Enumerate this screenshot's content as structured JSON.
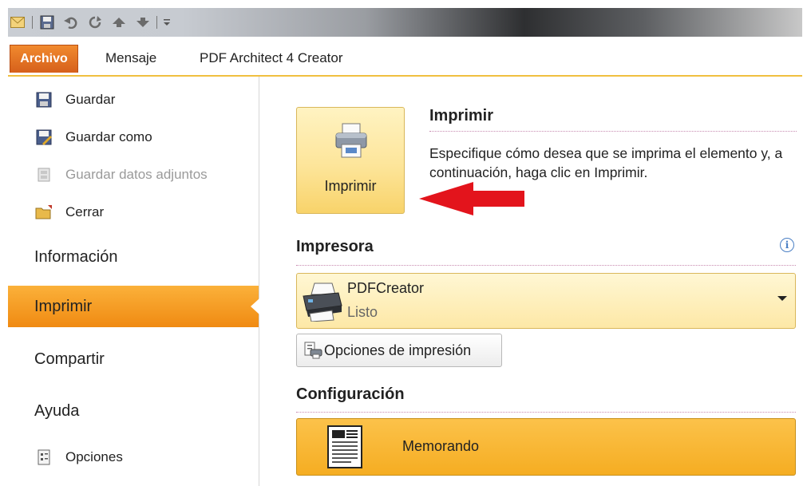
{
  "quick_access": {
    "icons": [
      "mail-icon",
      "save-icon",
      "undo-icon",
      "redo-icon",
      "up-arrow-icon",
      "down-arrow-icon",
      "customize-icon"
    ]
  },
  "tabs": [
    {
      "label": "Archivo",
      "active": true
    },
    {
      "label": "Mensaje"
    },
    {
      "label": "PDF Architect 4 Creator"
    }
  ],
  "left_nav": {
    "commands": [
      {
        "label": "Guardar",
        "icon": "save-icon",
        "enabled": true
      },
      {
        "label": "Guardar como",
        "icon": "save-as-icon",
        "enabled": true
      },
      {
        "label": "Guardar datos adjuntos",
        "icon": "attachments-icon",
        "enabled": false
      },
      {
        "label": "Cerrar",
        "icon": "folder-close-icon",
        "enabled": true
      }
    ],
    "items": [
      {
        "label": "Información"
      },
      {
        "label": "Imprimir",
        "selected": true
      },
      {
        "label": "Compartir"
      },
      {
        "label": "Ayuda"
      }
    ],
    "options": {
      "label": "Opciones",
      "icon": "options-icon"
    }
  },
  "print": {
    "button_label": "Imprimir",
    "title": "Imprimir",
    "description": "Especifique cómo desea que se imprima el elemento y, a continuación, haga clic en Imprimir."
  },
  "printer": {
    "section_title": "Impresora",
    "name": "PDFCreator",
    "status": "Listo",
    "options_button": "Opciones de impresión"
  },
  "settings": {
    "section_title": "Configuración",
    "style": "Memorando"
  },
  "colors": {
    "archivo_tab": "#e2712a",
    "selected_nav": "#f59c1e",
    "arrow": "#e3141c",
    "memo_box": "#f7b52e"
  }
}
